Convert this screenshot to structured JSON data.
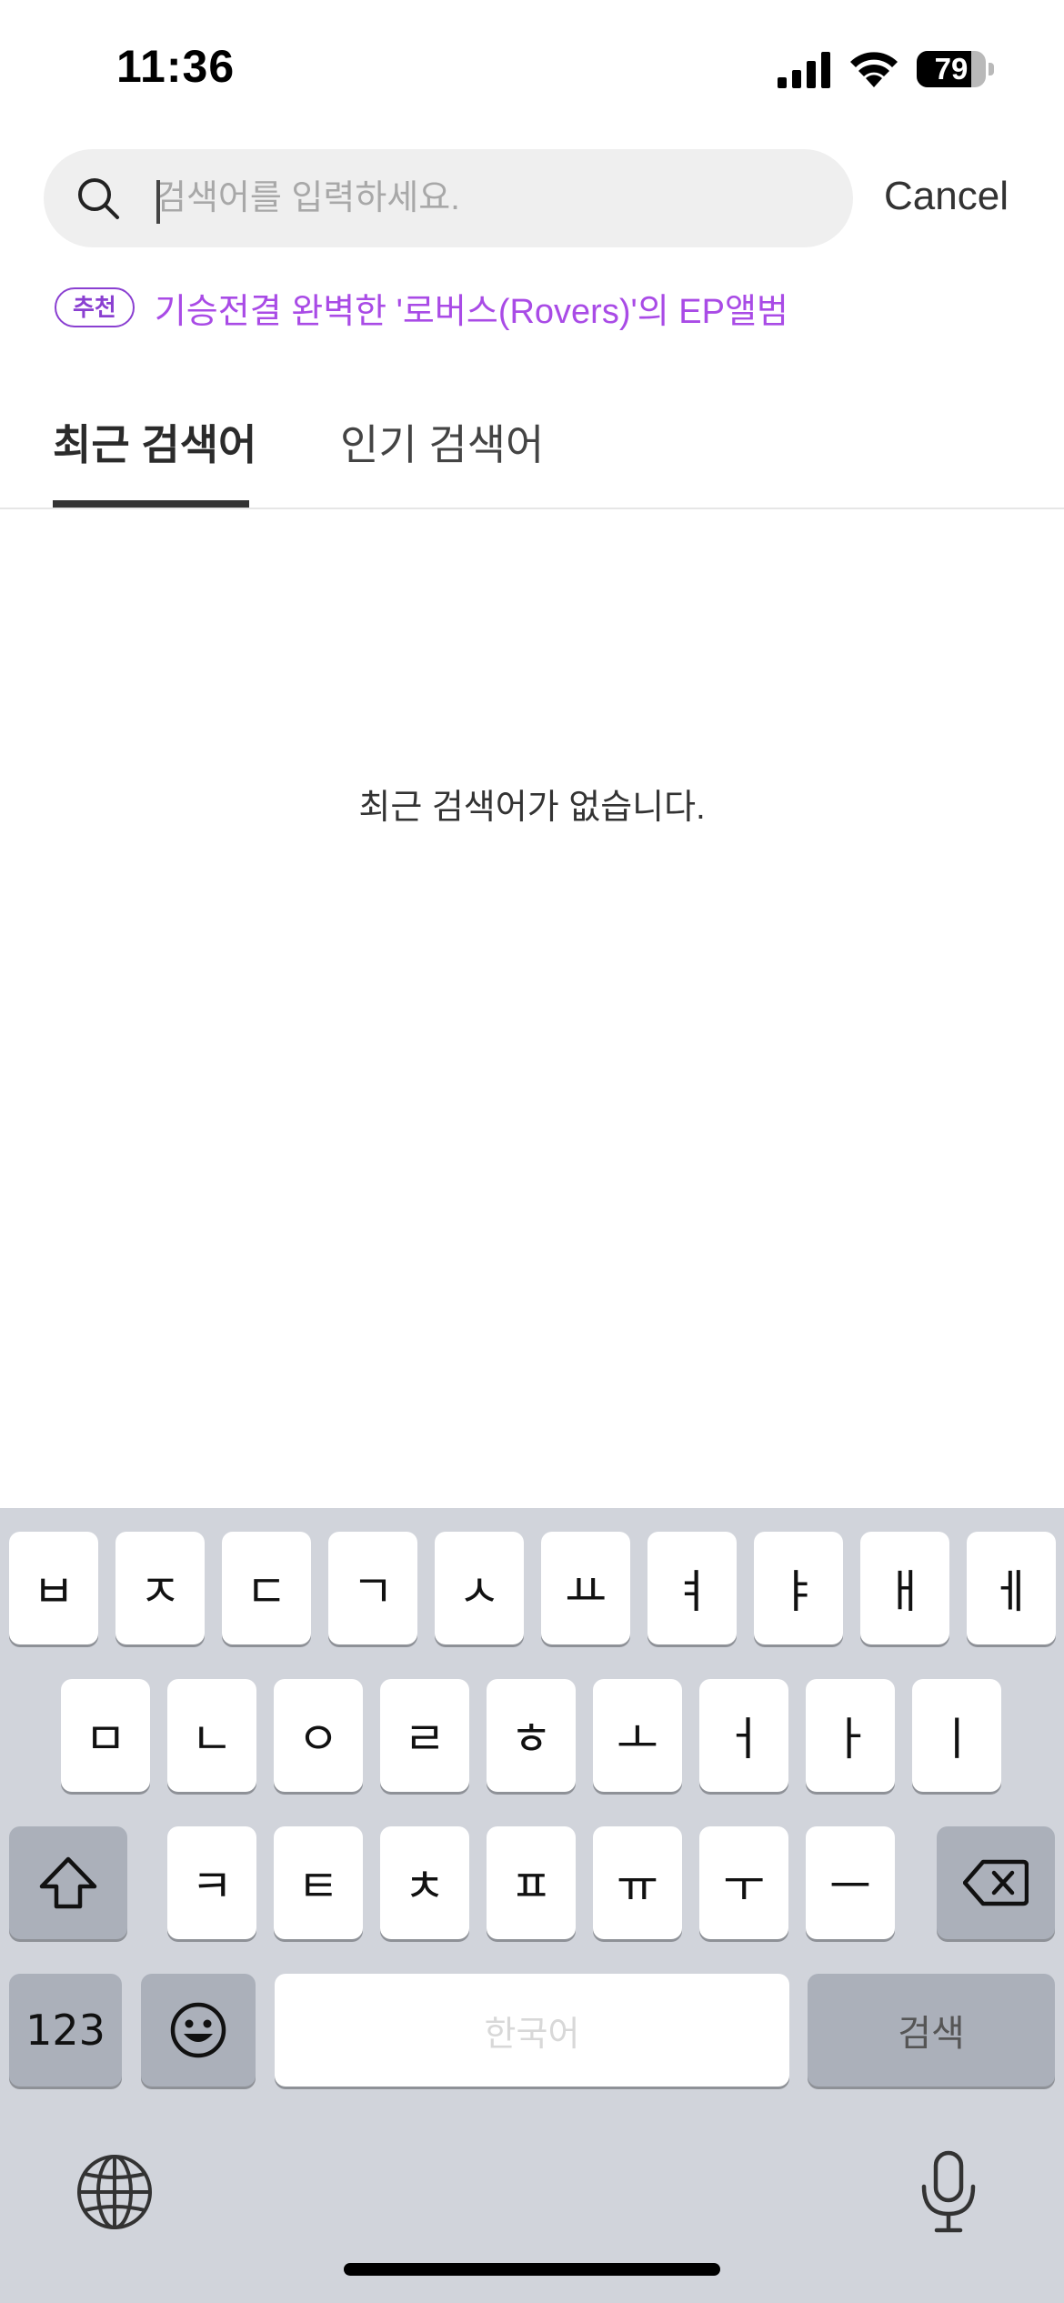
{
  "status_bar": {
    "time": "11:36",
    "battery_level": "79",
    "battery_fraction": 0.79,
    "icons": [
      "cellular-signal-icon",
      "wifi-icon",
      "battery-icon"
    ]
  },
  "search": {
    "placeholder": "검색어를 입력하세요.",
    "value": "",
    "cancel_label": "Cancel",
    "icon": "search-icon"
  },
  "recommendation": {
    "badge": "추천",
    "text": "기승전결 완벽한 '로버스(Rovers)'의 EP앨범",
    "color": "#a94be6"
  },
  "tabs": [
    {
      "label": "최근 검색어",
      "active": true
    },
    {
      "label": "인기 검색어",
      "active": false
    }
  ],
  "empty_message": "최근 검색어가 없습니다.",
  "keyboard": {
    "row1": [
      "ㅂ",
      "ㅈ",
      "ㄷ",
      "ㄱ",
      "ㅅ",
      "ㅛ",
      "ㅕ",
      "ㅑ",
      "ㅐ",
      "ㅔ"
    ],
    "row2": [
      "ㅁ",
      "ㄴ",
      "ㅇ",
      "ㄹ",
      "ㅎ",
      "ㅗ",
      "ㅓ",
      "ㅏ",
      "ㅣ"
    ],
    "row3": [
      "ㅋ",
      "ㅌ",
      "ㅊ",
      "ㅍ",
      "ㅠ",
      "ㅜ",
      "ㅡ"
    ],
    "numbers_label": "123",
    "space_label": "한국어",
    "search_label": "검색",
    "icons": [
      "shift-icon",
      "delete-icon",
      "emoji-icon",
      "globe-icon",
      "microphone-icon"
    ]
  }
}
